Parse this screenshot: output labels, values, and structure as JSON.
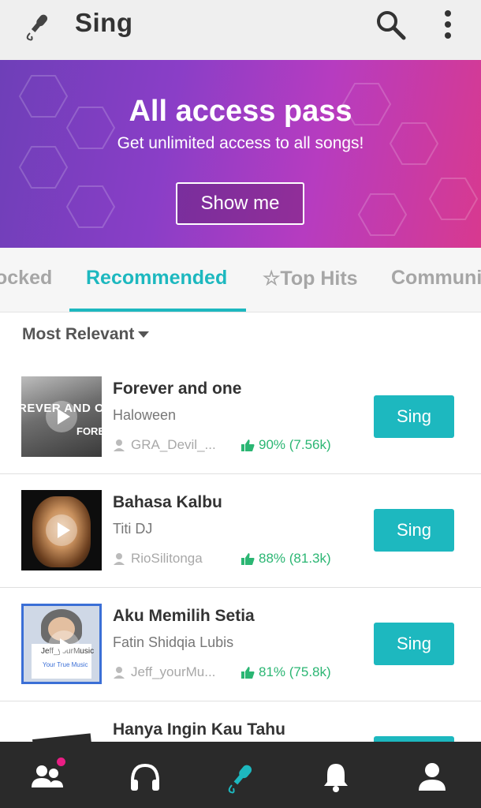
{
  "app": {
    "title": "Sing"
  },
  "banner": {
    "title": "All access pass",
    "subtitle": "Get unlimited access to all songs!",
    "button_label": "Show me"
  },
  "tabs": [
    {
      "label": "ocked",
      "active": false
    },
    {
      "label": "Recommended",
      "active": true
    },
    {
      "label": "☆Top Hits",
      "active": false
    },
    {
      "label": "Communi",
      "active": false
    }
  ],
  "filter": {
    "label": "Most Relevant"
  },
  "songs": [
    {
      "title": "Forever and one",
      "artist": "Haloween",
      "user": "GRA_Devil_...",
      "rating": "90% (7.56k)",
      "button": "Sing"
    },
    {
      "title": "Bahasa Kalbu",
      "artist": "Titi DJ",
      "user": "RioSilitonga",
      "rating": "88% (81.3k)",
      "button": "Sing"
    },
    {
      "title": "Aku Memilih Setia",
      "artist": "Fatin Shidqia Lubis",
      "user": "Jeff_yourMu...",
      "rating": "81% (75.8k)",
      "button": "Sing"
    },
    {
      "title": "Hanya Ingin Kau Tahu",
      "artist": "",
      "user": "",
      "rating": "",
      "button": ""
    }
  ],
  "thumb_texts": {
    "song1": "REVER AND O",
    "song1b": "FORE",
    "song3": "Jeff_yourMusic",
    "song3b": "Your True Music"
  },
  "bottom_nav": [
    {
      "icon": "people-icon",
      "active": false,
      "badge": true
    },
    {
      "icon": "headphones-icon",
      "active": false
    },
    {
      "icon": "microphone-icon",
      "active": true
    },
    {
      "icon": "bell-icon",
      "active": false
    },
    {
      "icon": "profile-icon",
      "active": false
    }
  ],
  "colors": {
    "accent": "#1db8bf",
    "rating": "#2bb673",
    "badge": "#e91e84",
    "nav_bg": "#2a2a2a"
  }
}
